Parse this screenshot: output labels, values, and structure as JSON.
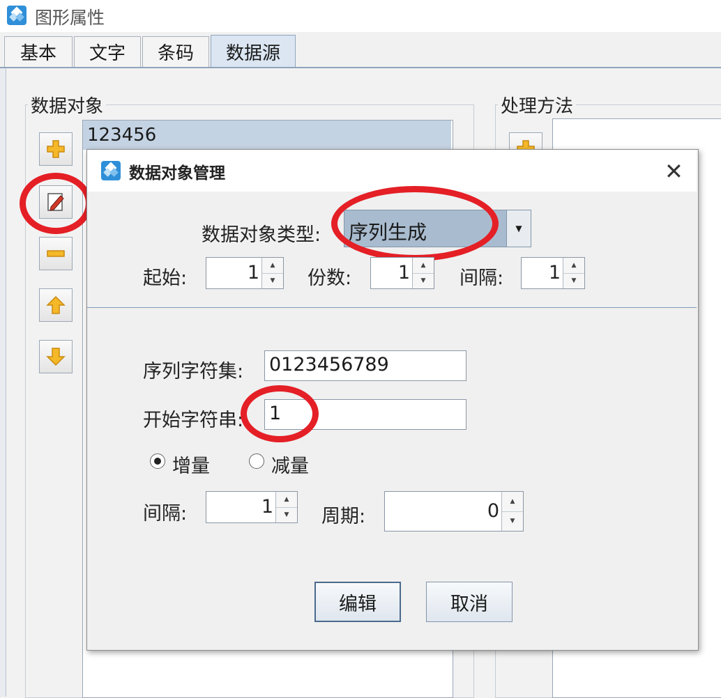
{
  "window": {
    "title": "图形属性"
  },
  "tabs": [
    {
      "label": "基本"
    },
    {
      "label": "文字"
    },
    {
      "label": "条码"
    },
    {
      "label": "数据源"
    }
  ],
  "data_objects": {
    "label": "数据对象",
    "items": [
      "123456"
    ]
  },
  "processing": {
    "label": "处理方法"
  },
  "dialog": {
    "title": "数据对象管理",
    "type_label": "数据对象类型:",
    "type_value": "序列生成",
    "start_label": "起始:",
    "start_value": "1",
    "copies_label": "份数:",
    "copies_value": "1",
    "interval_label": "间隔:",
    "interval_value": "1",
    "charset_label": "序列字符集:",
    "charset_value": "0123456789",
    "start_string_label": "开始字符串:",
    "start_string_value": "1",
    "increase_label": "增量",
    "decrease_label": "减量",
    "mode_selected": "增量",
    "step_label": "间隔:",
    "step_value": "1",
    "period_label": "周期:",
    "period_value": "0",
    "edit_button": "编辑",
    "cancel_button": "取消"
  },
  "colors": {
    "highlight_ring": "#e41f26",
    "selected_item_bg": "#c4d3e3",
    "active_tab_bg": "#dbe6f2"
  }
}
